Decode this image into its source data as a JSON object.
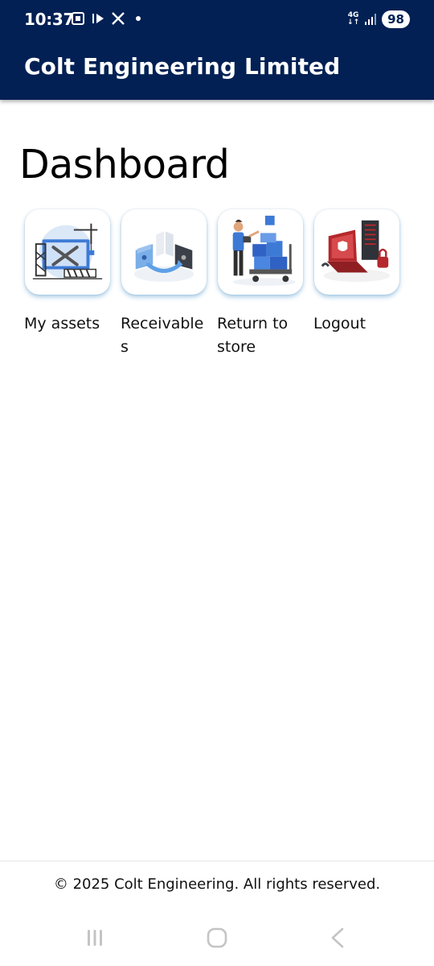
{
  "status_bar": {
    "time": "10:37",
    "network": "4G",
    "battery": "98"
  },
  "app_bar": {
    "title": "Colt Engineering Limited"
  },
  "dashboard": {
    "title": "Dashboard",
    "tiles": [
      {
        "label": "My assets",
        "icon": "assets-illustration-icon"
      },
      {
        "label": "Receivables",
        "icon": "receivables-illustration-icon"
      },
      {
        "label": "Return to store",
        "icon": "return-to-store-illustration-icon"
      },
      {
        "label": "Logout",
        "icon": "logout-illustration-icon"
      }
    ]
  },
  "footer": {
    "text": "© 2025 Colt Engineering. All rights reserved."
  },
  "colors": {
    "app_bar": "#022054",
    "accent_blue": "#3d7ad6",
    "accent_red": "#b5282c"
  }
}
